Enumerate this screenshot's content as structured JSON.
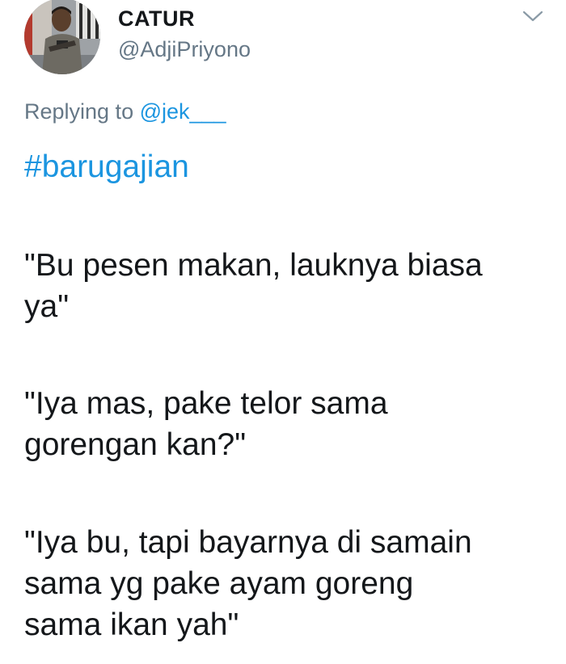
{
  "tweet": {
    "author": {
      "name": "CATUR",
      "handle": "@AdjiPriyono"
    },
    "reply": {
      "prefix": "Replying to ",
      "mention": "@jek___"
    },
    "hashtag": "#barugajian",
    "paragraphs": [
      {
        "lines": [
          "\"Bu pesen makan, lauknya biasa",
          "ya\""
        ]
      },
      {
        "lines": [
          "\"Iya mas, pake telor sama",
          "gorengan kan?\""
        ]
      },
      {
        "lines": [
          "\"Iya bu, tapi bayarnya di samain",
          "sama yg pake ayam goreng",
          "sama ikan yah\""
        ]
      }
    ],
    "icons": {
      "menu": "chevron-down-icon",
      "avatar": "profile-photo"
    },
    "colors": {
      "text": "#14171a",
      "secondary": "#657786",
      "link": "#1b95e0"
    }
  }
}
